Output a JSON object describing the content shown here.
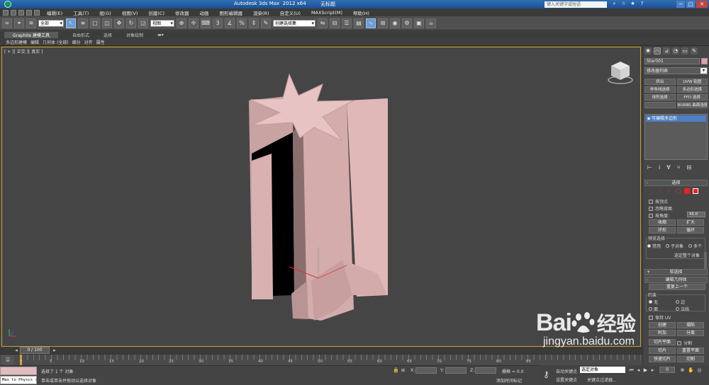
{
  "window": {
    "title": "Autodesk 3ds Max  2012 x64",
    "file": "无标题",
    "search_placeholder": "键入关键字或短语",
    "minimize": "─",
    "maximize": "□",
    "close": "✕"
  },
  "menu": [
    "编辑(E)",
    "工具(T)",
    "组(G)",
    "视图(V)",
    "创建(C)",
    "修改器",
    "动画",
    "图形编辑器",
    "渲染(R)",
    "自定义(U)",
    "MAXScript(M)",
    "帮助(H)"
  ],
  "toolbar": {
    "filter_select": "全部",
    "coord_select": "视图",
    "named_selection": "创建选择集"
  },
  "ribbon": {
    "tabs": [
      "Graphite 建模工具",
      "自由形式",
      "选择",
      "对象绘制"
    ],
    "sub": [
      "多边形建模",
      "编辑",
      "几何体 (全部)",
      "细分",
      "对齐",
      "属性"
    ]
  },
  "viewport": {
    "label": "[ + ][ 正交 ][ 真实 ]",
    "object_color": "#e0b0b0"
  },
  "command_panel": {
    "object_name": "Star001",
    "object_color": "#e4a0a6",
    "modifier_list": "修改器列表",
    "buttons": [
      "挤出",
      "UVW 贴图",
      "样条线选择",
      "多边形选择",
      "体积选择",
      "FFD 选择",
      "",
      "NURBS 曲面选择"
    ],
    "stack_item": "可编辑多边形",
    "stack_tools": [
      "⊢",
      "ⅰ",
      "∀",
      "⑂",
      "⊟"
    ],
    "selection_title": "选择",
    "by_vertex": "按顶点",
    "ignore_backfacing": "忽略背面",
    "by_angle": "按角度:",
    "angle_value": "45.0",
    "shrink": "收缩",
    "grow": "扩大",
    "ring": "环形",
    "loop": "循环",
    "preview_title": "预览选择",
    "preview_options": [
      "禁用",
      "子对象",
      "多个"
    ],
    "whole_object": "选定整个对象",
    "soft_selection": "软选择",
    "edit_geometry": "编辑几何体",
    "repeat_last": "重复上一个",
    "constraints_title": "约束",
    "constraints": [
      "无",
      "边",
      "面",
      "法线"
    ],
    "preserve_uv": "保持 UV",
    "create": "创建",
    "collapse": "塌陷",
    "attach": "附加",
    "detach": "分离",
    "slice_plane": "切片平面",
    "split": "分割",
    "slice": "切片",
    "reset_plane": "重置平面",
    "quickslice": "快速切片",
    "cut": "切割"
  },
  "timeline": {
    "frame": "0 / 100",
    "ticks": [
      "0",
      "5",
      "10",
      "15",
      "20",
      "25",
      "30",
      "35",
      "40",
      "45",
      "50",
      "55",
      "60",
      "65",
      "70",
      "75",
      "80",
      "85"
    ]
  },
  "status": {
    "maxscript": "Max to Physcs (",
    "selected": "选择了 1 个 对象",
    "prompt": "单击或单击并拖动以选择对象",
    "x_label": "X:",
    "y_label": "Y:",
    "z_label": "Z:",
    "grid": "栅格 = 0.0",
    "add_time_tag": "添加时间标记"
  },
  "animation": {
    "auto_key": "自动关键点",
    "selected_obj": "选定对象",
    "set_key": "设置关键点",
    "key_filters": "关键点过滤器...",
    "frame_value": "0"
  },
  "watermark": {
    "logo": "Bai",
    "logo2": "经验",
    "url": "jingyan.baidu.com"
  }
}
